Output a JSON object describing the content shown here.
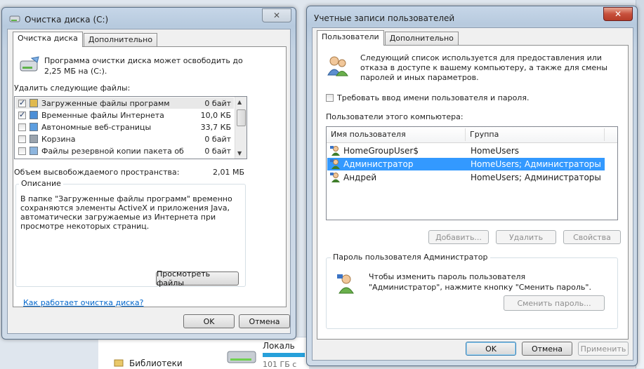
{
  "disk_cleanup": {
    "title": "Очистка диска  (C:)",
    "close": "✕",
    "tabs": [
      "Очистка диска",
      "Дополнительно"
    ],
    "intro": "Программа очистки диска может освободить до 2,25 МБ на  (C:).",
    "delete_label": "Удалить следующие файлы:",
    "files": [
      {
        "name": "Загруженные файлы программ",
        "size": "0 байт",
        "checked": true
      },
      {
        "name": "Временные файлы Интернета",
        "size": "10,0 КБ",
        "checked": true
      },
      {
        "name": "Автономные веб-страницы",
        "size": "33,7 КБ",
        "checked": false
      },
      {
        "name": "Корзина",
        "size": "0 байт",
        "checked": false
      },
      {
        "name": "Файлы резервной копии пакета об...",
        "size": "0 байт",
        "checked": false
      }
    ],
    "freed_label": "Объем высвобождаемого пространства:",
    "freed_value": "2,01 МБ",
    "description_label": "Описание",
    "description": "В папке \"Загруженные файлы программ\" временно сохраняются элементы ActiveX и приложения Java, автоматически загружаемые из Интернета при просмотре некоторых страниц.",
    "view_files": "Просмотреть файлы",
    "how_link": "Как работает очистка диска?",
    "ok": "OK",
    "cancel": "Отмена"
  },
  "user_accounts": {
    "title": "Учетные записи пользователей",
    "close": "✕",
    "tabs": [
      "Пользователи",
      "Дополнительно"
    ],
    "intro": "Следующий список используется для предоставления или отказа в доступе к вашему компьютеру, а также для смены паролей и иных параметров.",
    "require_login": "Требовать ввод имени пользователя и пароля.",
    "users_label": "Пользователи этого компьютера:",
    "columns": [
      "Имя пользователя",
      "Группа"
    ],
    "users": [
      {
        "name": "HomeGroupUser$",
        "group": "HomeUsers"
      },
      {
        "name": "Администратор",
        "group": "HomeUsers; Администраторы"
      },
      {
        "name": "Андрей",
        "group": "HomeUsers; Администраторы"
      }
    ],
    "add": "Добавить...",
    "remove": "Удалить",
    "properties": "Свойства",
    "password_group": "Пароль пользователя Администратор",
    "password_text": "Чтобы изменить пароль пользователя \"Администратор\", нажмите кнопку \"Сменить пароль\".",
    "change_password": "Сменить пароль...",
    "ok": "OK",
    "cancel": "Отмена",
    "apply": "Применить"
  },
  "background": {
    "libraries": "Библиотеки",
    "local_disk": "Локаль",
    "disk_free": "101 ГБ с"
  },
  "colors": {
    "selection": "#3399ff",
    "link": "#0066cc"
  }
}
